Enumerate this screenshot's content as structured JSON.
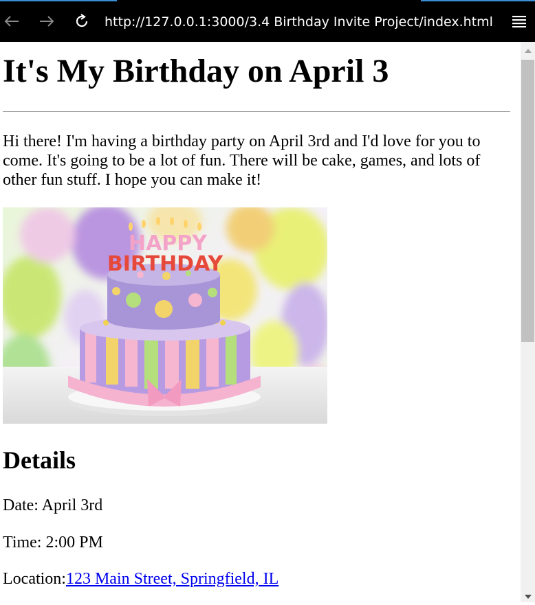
{
  "browser": {
    "url": "http://127.0.0.1:3000/3.4 Birthday Invite Project/index.html",
    "back_icon": "arrow-left-icon",
    "forward_icon": "arrow-right-icon",
    "reload_icon": "reload-icon",
    "menu_icon": "hamburger-menu-icon"
  },
  "page": {
    "heading": "It's My Birthday on April 3",
    "intro": "Hi there! I'm having a birthday party on April 3rd and I'd love for you to come. It's going to be a lot of fun. There will be cake, games, and lots of other fun stuff. I hope you can make it!",
    "image": {
      "candle_text_top": "HAPPY",
      "candle_text_bottom": "BIRTHDAY"
    },
    "details_heading": "Details",
    "date": "Date: April 3rd",
    "time": "Time: 2:00 PM",
    "location_label": "Location:",
    "location_link": "123 Main Street, Springfield, IL"
  },
  "colors": {
    "link": "#0000ee",
    "toolbar_bg": "#000000",
    "scrollbar_thumb": "#c1c1c1"
  }
}
